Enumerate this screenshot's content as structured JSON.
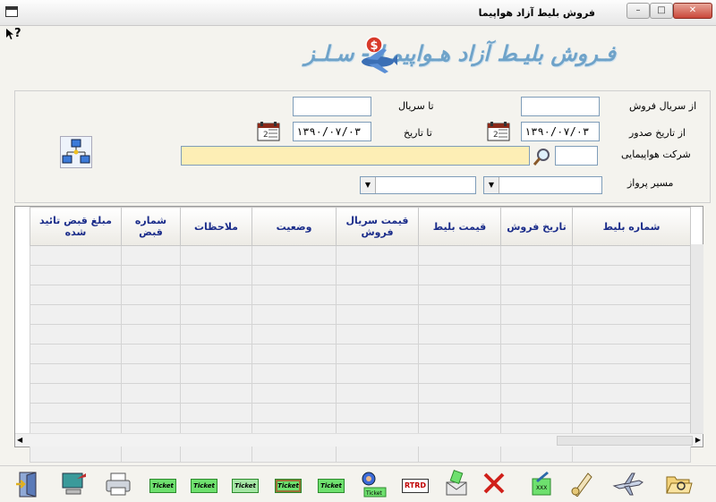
{
  "window": {
    "title": "فروش بلیط آزاد هواپیما",
    "help_glyph": "?",
    "min_glyph": "–",
    "max_glyph": "□",
    "close_glyph": "✕"
  },
  "banner": {
    "text": "فـروش بليـط آزاد هـواپيمـا - سـلـز"
  },
  "filters": {
    "from_serial_label": "از سریال فروش",
    "to_serial_label": "تا سریال",
    "from_date_label": "از تاریخ صدور",
    "to_date_label": "تا تاریخ",
    "from_date_value": "۱۳۹۰/۰۷/۰۳",
    "to_date_value": "۱۳۹۰/۰۷/۰۳",
    "airline_label": "شرکت هواپیمایی",
    "route_label": "مسیر پرواز",
    "from_serial_value": "",
    "to_serial_value": "",
    "airline_code_value": "",
    "airline_name_value": ""
  },
  "grid": {
    "columns": [
      "شماره بلیط",
      "تاریخ فروش",
      "قیمت بلیط",
      "قیمت سریال فروش",
      "وضعیت",
      "ملاحظات",
      "شماره قبض",
      "مبلغ قبض تائید شده"
    ],
    "row_count": 11
  },
  "toolbar": {
    "ticket_label": "Ticket",
    "rtrd_label": "RTRD",
    "buttons": [
      "open-folder",
      "airplane",
      "scroll",
      "ticket-report",
      "delete",
      "email",
      "rtrd",
      "search-ticket",
      "ticket-edit",
      "ticket-cut",
      "ticket-cancel",
      "ticket-edit-2",
      "ticket-add",
      "print",
      "computer",
      "exit"
    ]
  }
}
